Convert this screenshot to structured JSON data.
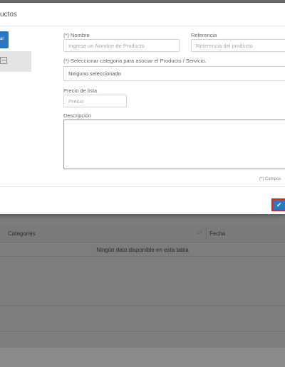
{
  "modal": {
    "title": "uctos",
    "side_button_label": "ar",
    "nombre": {
      "label": "(*) Nombre",
      "placeholder": "Ingrese un Nombre de Producto"
    },
    "referencia": {
      "label": "Referencia",
      "placeholder": "Referencia del producto"
    },
    "categoria": {
      "label": "(*) Seleccionar categoria para asociar el Producto / Servicio.",
      "value": "Ninguno seleccionado"
    },
    "precio": {
      "label": "Precio de lista",
      "placeholder": "Precio"
    },
    "descripcion": {
      "label": "Descripción"
    },
    "required_note": "(*) Campos",
    "save_icon": "check-icon"
  },
  "table": {
    "columns": [
      "Categorias",
      "Fecha"
    ],
    "sort_icon": "↓↑",
    "empty_message": "Ningún dato disponible en esta tabla"
  },
  "colors": {
    "accent": "#2a78bf",
    "highlight": "#d62424",
    "overlay": "#7d7d7d"
  }
}
